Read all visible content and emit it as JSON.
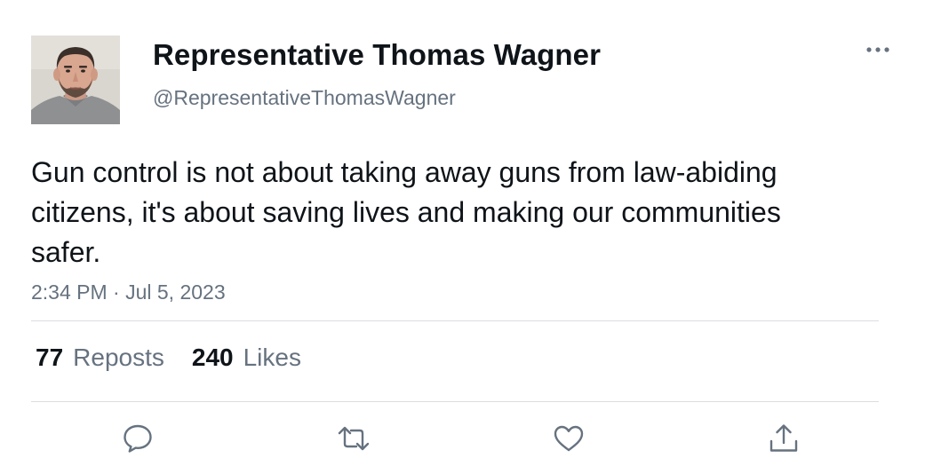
{
  "author": {
    "display_name": "Representative Thomas Wagner",
    "handle": "@RepresentativeThomasWagner"
  },
  "tweet": {
    "text": "Gun control is not about taking away guns from law-abiding citizens, it's about saving lives and making our communities safer.",
    "timestamp": "2:34 PM · Jul 5, 2023"
  },
  "stats": {
    "reposts_count": "77",
    "reposts_label": "Reposts",
    "likes_count": "240",
    "likes_label": "Likes"
  },
  "icons": {
    "more": "more-horizontal-icon",
    "reply": "reply-icon",
    "repost": "repost-icon",
    "like": "heart-icon",
    "share": "share-icon"
  },
  "colors": {
    "text_primary": "#0f1419",
    "text_secondary": "#66727f",
    "divider": "#dadde1"
  }
}
